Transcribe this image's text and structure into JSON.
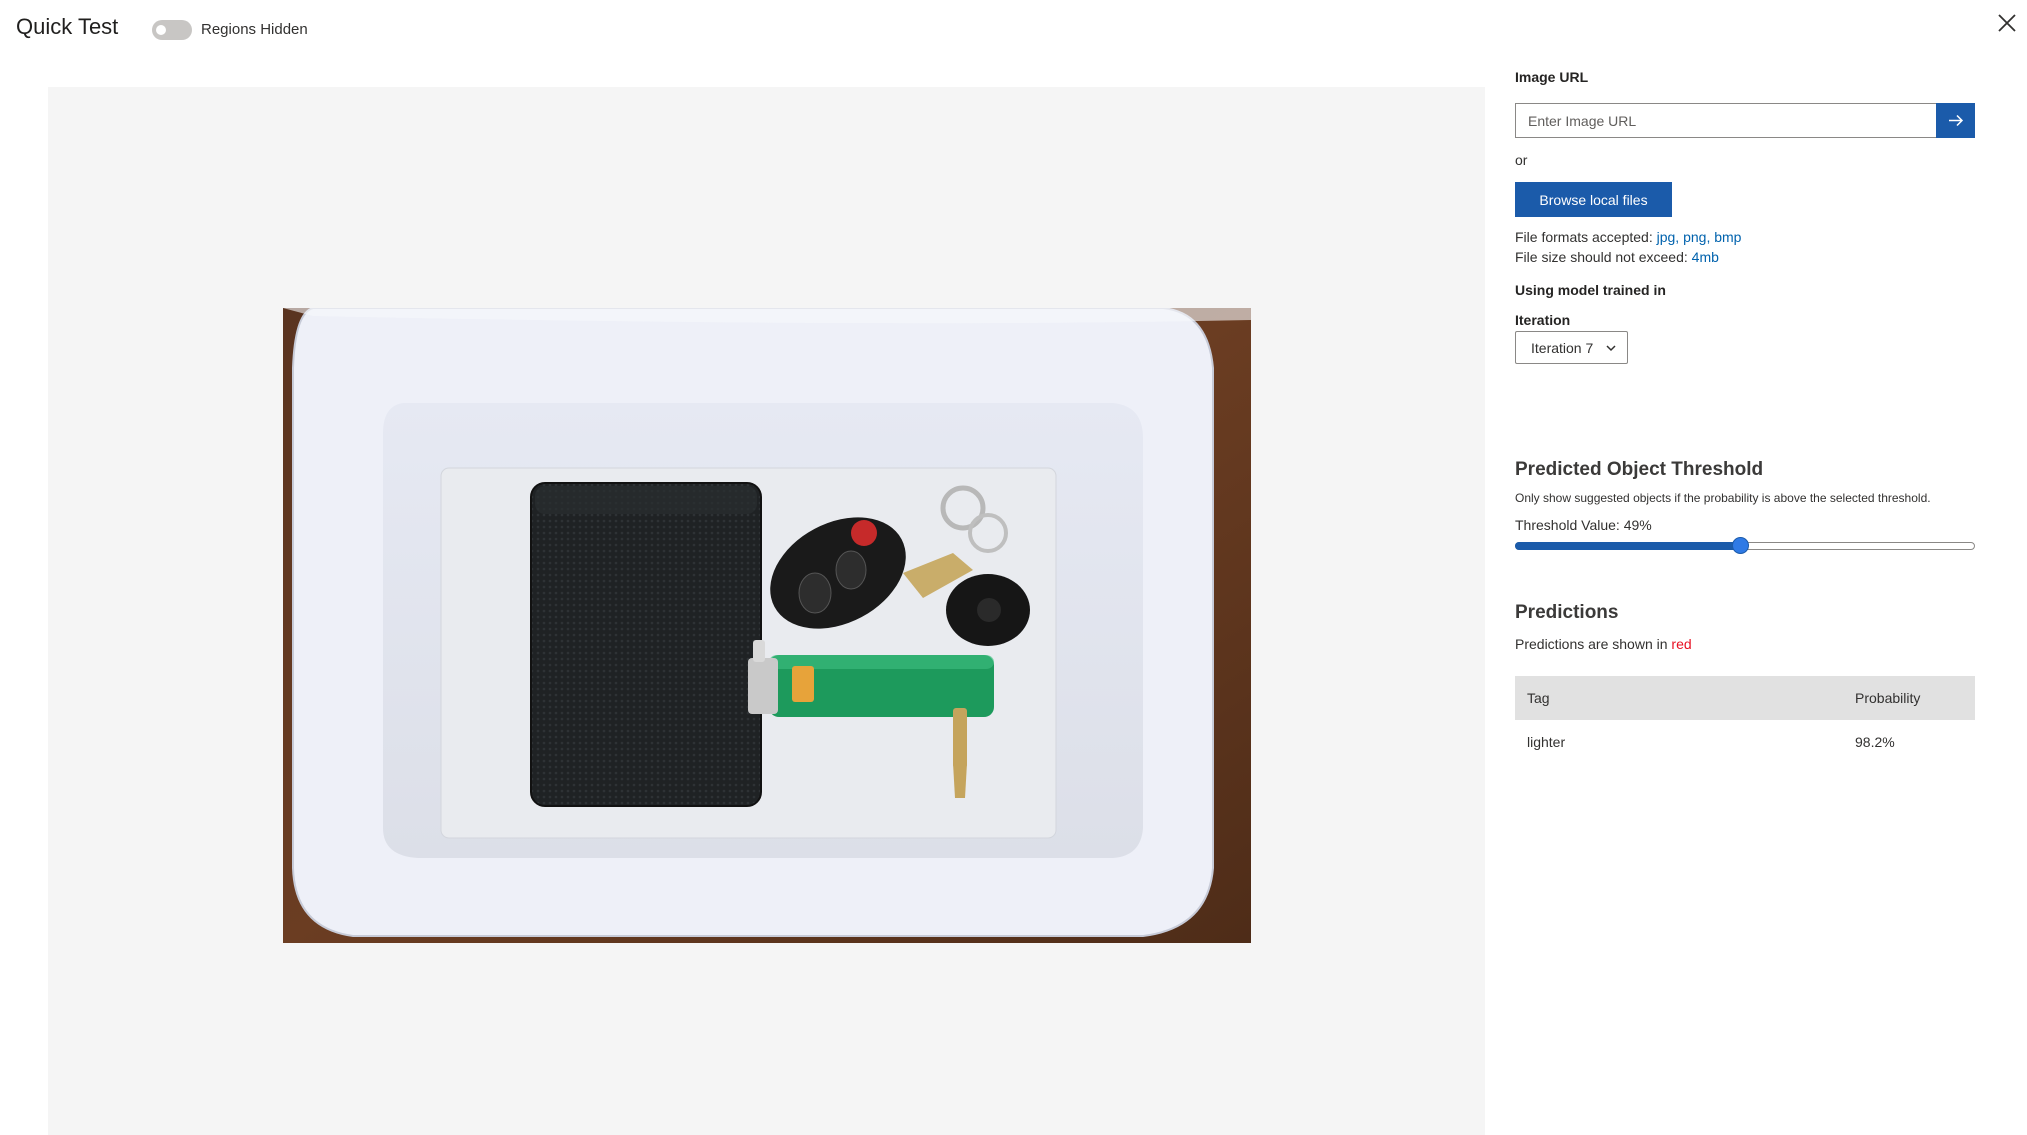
{
  "header": {
    "title": "Quick Test",
    "toggle_label": "Regions Hidden",
    "toggle_on": false,
    "close_icon": "close-icon"
  },
  "panel": {
    "image_url_label": "Image URL",
    "image_url_placeholder": "Enter Image URL",
    "image_url_value": "",
    "submit_icon": "arrow-right-icon",
    "or_text": "or",
    "browse_label": "Browse local files",
    "formats_prefix": "File formats accepted: ",
    "formats_value": "jpg, png, bmp",
    "size_prefix": "File size should not exceed: ",
    "size_value": "4mb",
    "model_label": "Using model trained in",
    "iteration_label": "Iteration",
    "iteration_value": "Iteration 7",
    "threshold_title": "Predicted Object Threshold",
    "threshold_desc": "Only show suggested objects if the probability is above the selected threshold.",
    "threshold_value_label": "Threshold Value: 49%",
    "threshold_value": 0.49,
    "predictions_title": "Predictions",
    "predictions_desc_prefix": "Predictions are shown in ",
    "predictions_desc_color": "red",
    "table": {
      "columns": [
        "Tag",
        "Probability"
      ],
      "rows": [
        {
          "tag": "lighter",
          "probability": "98.2%"
        }
      ]
    }
  },
  "colors": {
    "accent": "#1b5baa",
    "link": "#0062ad",
    "prediction": "#e81123",
    "canvas_bg": "#f5f5f5"
  }
}
